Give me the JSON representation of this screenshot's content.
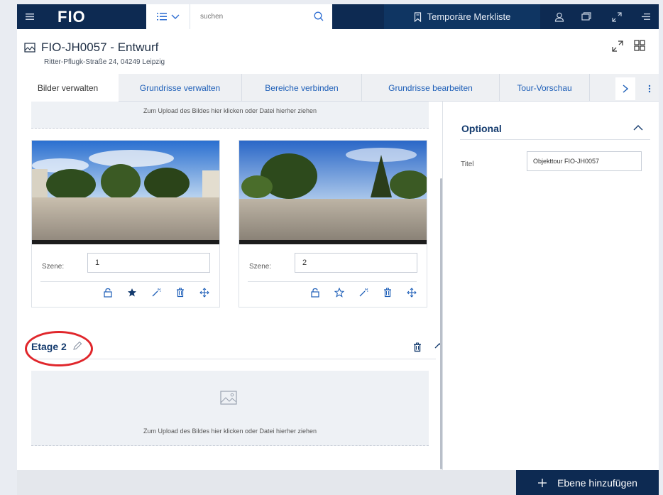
{
  "topbar": {
    "logo": "FIO",
    "search_placeholder": "suchen",
    "merkliste_label": "Temporäre Merkliste"
  },
  "header": {
    "title": "FIO-JH0057 - Entwurf",
    "address": "Ritter-Pflugk-Straße 24, 04249 Leipzig"
  },
  "tabs": [
    {
      "label": "Bilder verwalten",
      "active": true
    },
    {
      "label": "Grundrisse verwalten"
    },
    {
      "label": "Bereiche verbinden"
    },
    {
      "label": "Grundrisse bearbeiten"
    },
    {
      "label": "Tour-Vorschau"
    }
  ],
  "upload_text": "Zum Upload des Bildes hier klicken oder Datei hierher ziehen",
  "scenes": [
    {
      "label": "Szene:",
      "value": "1",
      "starred": true
    },
    {
      "label": "Szene:",
      "value": "2",
      "starred": false
    }
  ],
  "etage": {
    "title": "Etage 2"
  },
  "optional": {
    "title": "Optional",
    "titel_label": "Titel",
    "titel_value": "Objekttour FIO-JH0057"
  },
  "footer": {
    "add_label": "Ebene hinzufügen"
  },
  "colors": {
    "navy": "#0d2a52",
    "accent": "#1e5fb8",
    "highlight": "#e0262b"
  }
}
